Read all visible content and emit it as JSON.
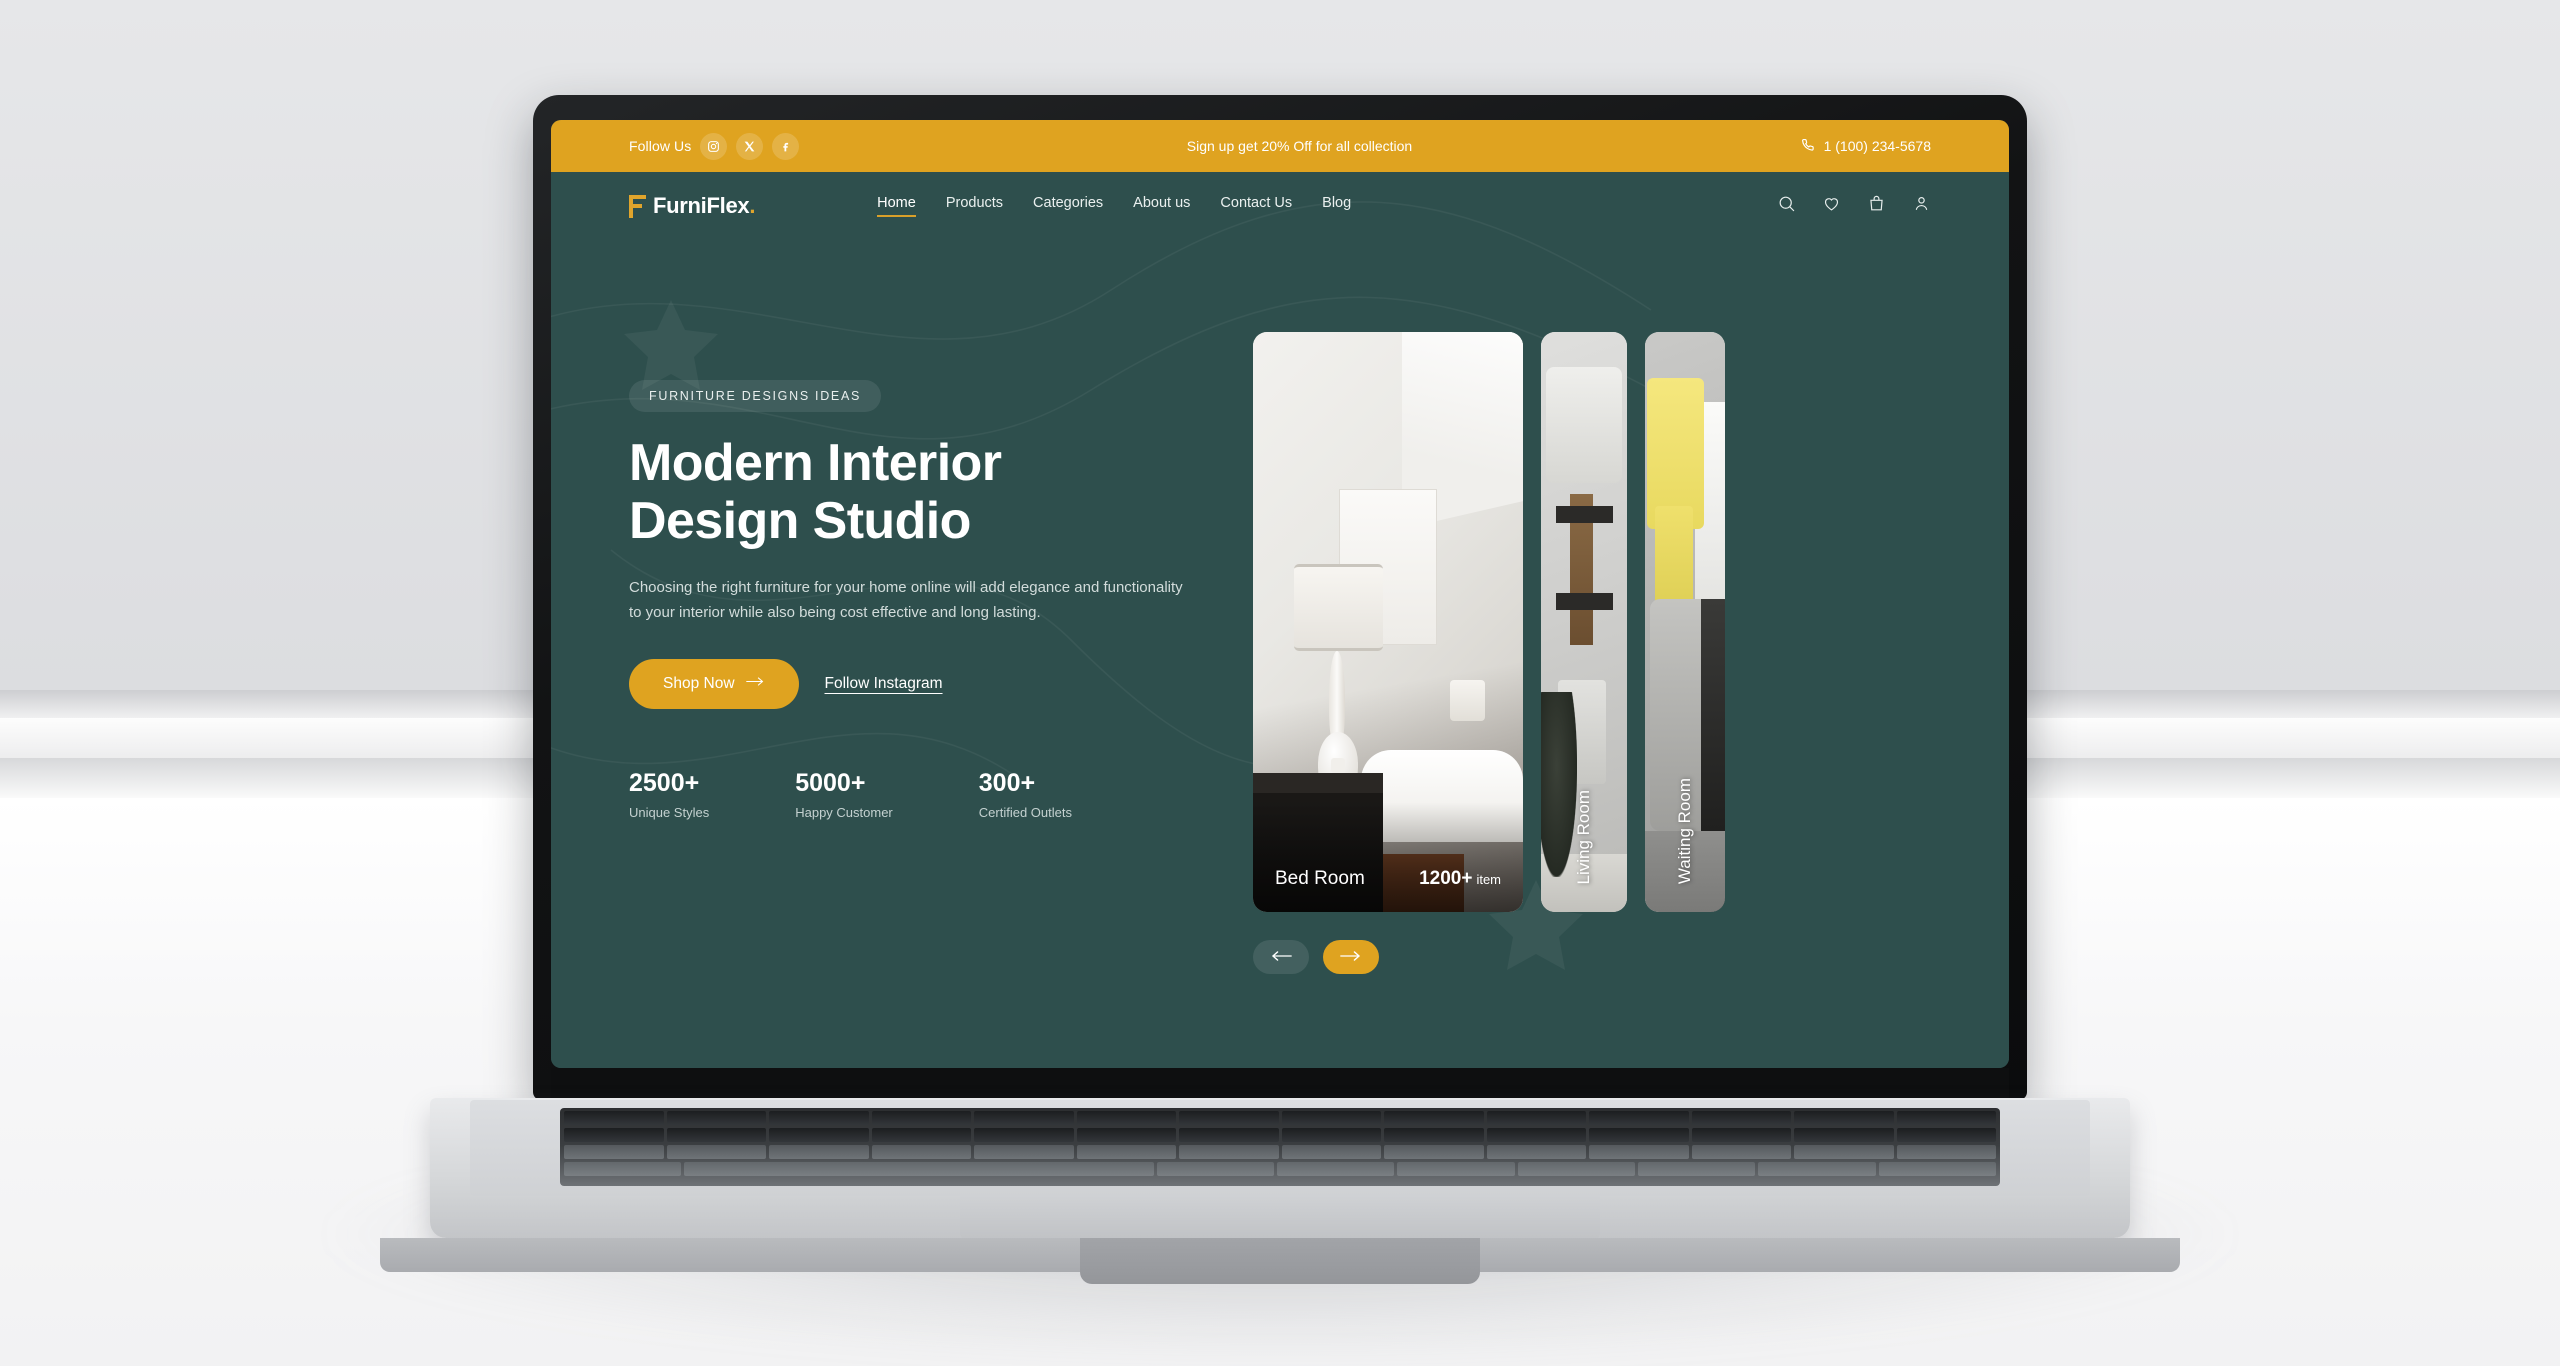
{
  "topbar": {
    "follow_label": "Follow Us",
    "social": [
      {
        "name": "instagram-icon",
        "label": "Instagram"
      },
      {
        "name": "x-icon",
        "label": "X"
      },
      {
        "name": "facebook-icon",
        "label": "Facebook"
      }
    ],
    "promo": "Sign up get 20% Off for all collection",
    "phone": "1 (100) 234-5678",
    "background_color": "#dfa320"
  },
  "nav": {
    "logo_text": "FurniFlex",
    "logo_dot": ".",
    "items": [
      {
        "label": "Home",
        "active": true
      },
      {
        "label": "Products",
        "active": false
      },
      {
        "label": "Categories",
        "active": false
      },
      {
        "label": "About us",
        "active": false
      },
      {
        "label": "Contact Us",
        "active": false
      },
      {
        "label": "Blog",
        "active": false
      }
    ],
    "icons": [
      "search-icon",
      "wishlist-heart-icon",
      "cart-bag-icon",
      "user-account-icon"
    ]
  },
  "hero": {
    "eyebrow": "FURNITURE DESIGNS IDEAS",
    "title_line1": "Modern Interior",
    "title_line2": "Design Studio",
    "paragraph": "Choosing the right furniture for your home online will add elegance and  functionality to your interior while also being cost effective and long lasting.",
    "primary_button": "Shop Now",
    "secondary_link": "Follow Instagram",
    "stats": [
      {
        "value": "2500+",
        "label": "Unique Styles"
      },
      {
        "value": "5000+",
        "label": "Happy Customer"
      },
      {
        "value": "300+",
        "label": "Certified Outlets"
      }
    ]
  },
  "carousel": {
    "cards": [
      {
        "name": "Bed Room",
        "count": "1200+",
        "count_unit": "item",
        "orientation": "horizontal"
      },
      {
        "name": "Living Room",
        "orientation": "vertical"
      },
      {
        "name": "Waiting Room",
        "orientation": "vertical"
      }
    ],
    "prev_label": "Previous",
    "next_label": "Next"
  },
  "theme": {
    "brand_green": "#2e4f4d",
    "brand_gold": "#dfa320",
    "text_light": "#ffffff",
    "muted_text": "#d2dcdb"
  }
}
